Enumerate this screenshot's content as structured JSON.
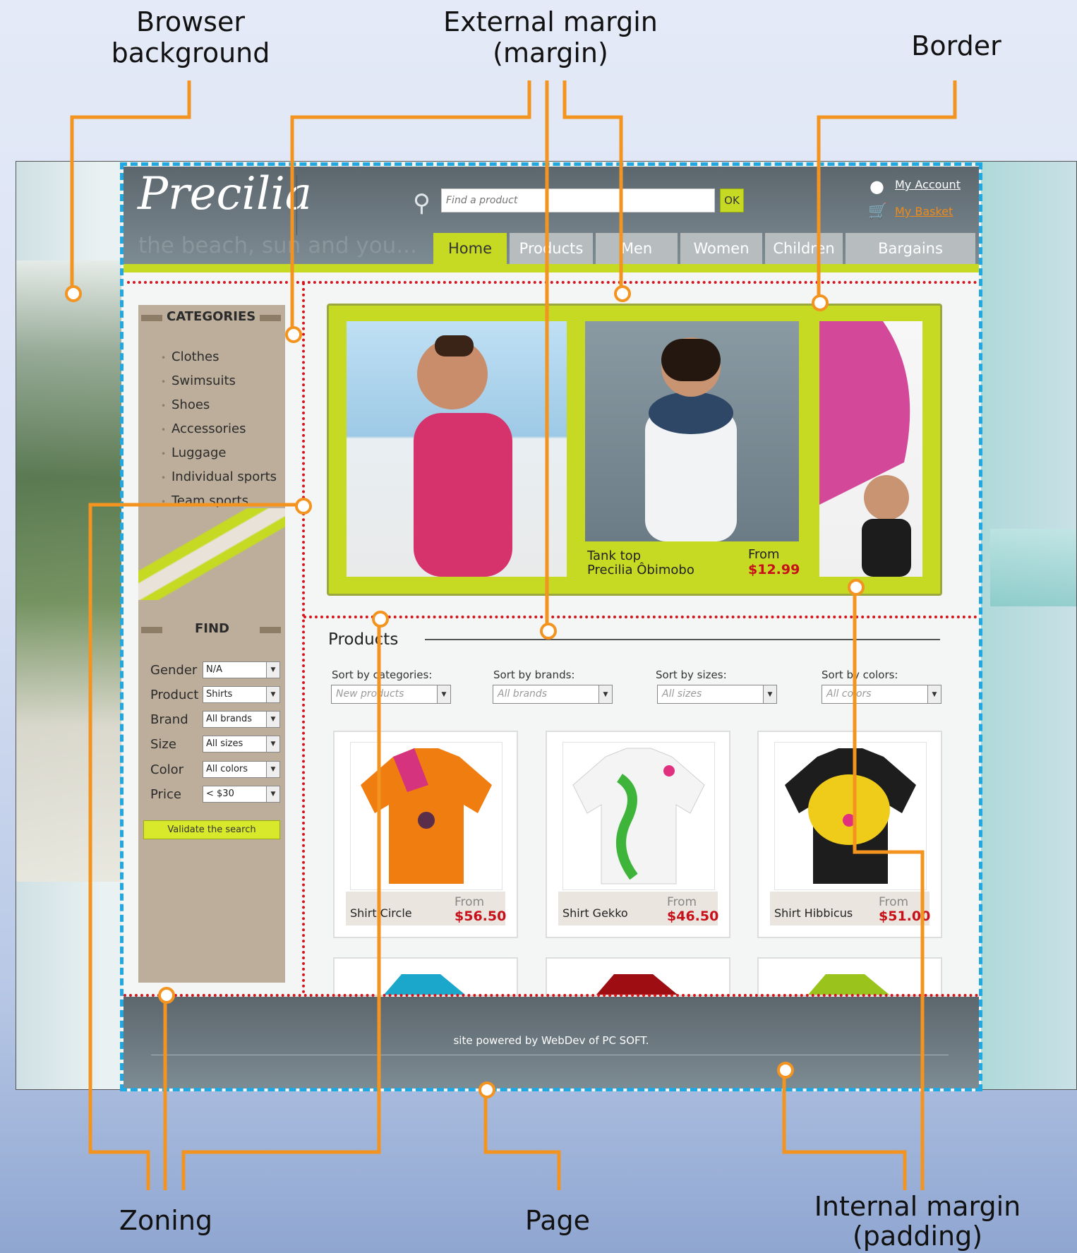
{
  "callouts": {
    "browser_background": "Browser\nbackground",
    "external_margin_line1": "External margin",
    "external_margin_line2": "(margin)",
    "border": "Border",
    "zoning": "Zoning",
    "page": "Page",
    "internal_margin_line1": "Internal margin",
    "internal_margin_line2": "(padding)"
  },
  "site": {
    "logo": "Precilia",
    "tagline": "the beach, sun and you...",
    "search_placeholder": "Find a product",
    "ok_label": "OK",
    "my_account": "My Account",
    "my_basket": "My Basket",
    "nav": [
      "Home",
      "Products",
      "Men",
      "Women",
      "Children",
      "Bargains"
    ]
  },
  "sidebar": {
    "categories_title": "CATEGORIES",
    "categories": [
      "Clothes",
      "Swimsuits",
      "Shoes",
      "Accessories",
      "Luggage",
      "Individual sports",
      "Team sports"
    ],
    "find_title": "FIND",
    "filters": [
      {
        "label": "Gender",
        "value": "N/A"
      },
      {
        "label": "Product",
        "value": "Shirts"
      },
      {
        "label": "Brand",
        "value": "All brands"
      },
      {
        "label": "Size",
        "value": "All sizes"
      },
      {
        "label": "Color",
        "value": "All colors"
      },
      {
        "label": "Price",
        "value": "< $30"
      }
    ],
    "validate_label": "Validate the search"
  },
  "banner": {
    "item_line1": "Tank top",
    "item_line2": "Precilia Ôbimobo",
    "from_label": "From",
    "price": "$12.99"
  },
  "products": {
    "title": "Products",
    "sorts": [
      {
        "label": "Sort by categories:",
        "value": "New products"
      },
      {
        "label": "Sort by brands:",
        "value": "All brands"
      },
      {
        "label": "Sort by sizes:",
        "value": "All sizes"
      },
      {
        "label": "Sort by colors:",
        "value": "All colors"
      }
    ],
    "items": [
      {
        "name": "Shirt Circle",
        "from": "From",
        "price": "$56.50"
      },
      {
        "name": "Shirt Gekko",
        "from": "From",
        "price": "$46.50"
      },
      {
        "name": "Shirt Hibbicus",
        "from": "From",
        "price": "$51.00"
      }
    ]
  },
  "footer": {
    "text": "site powered by WebDev of PC SOFT."
  },
  "colors": {
    "callout_orange": "#f39320",
    "page_border_blue": "#22a8e0",
    "zoning_red": "#d2161c",
    "accent_lime": "#c6d923",
    "price_red": "#c8101a"
  }
}
